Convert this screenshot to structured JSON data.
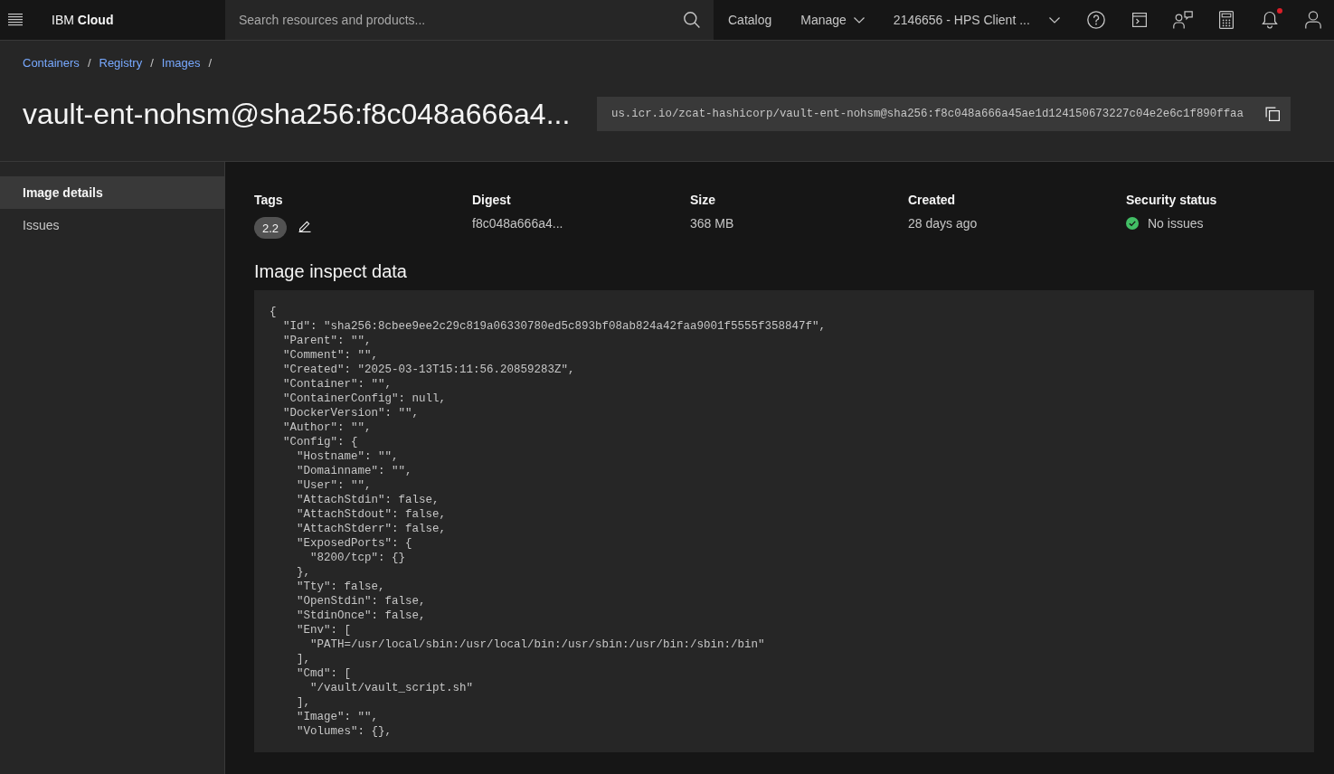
{
  "header": {
    "brand": "IBM **Cloud**",
    "search": {
      "placeholder": "Search resources and products..."
    },
    "nav": [
      {
        "label": "Catalog",
        "kind": "link"
      },
      {
        "label": "Manage",
        "kind": "menu"
      }
    ],
    "account": "2146656 - HPS Client ...",
    "notifications_unread": true
  },
  "breadcrumbs": {
    "items": [
      "Containers",
      "Registry",
      "Images"
    ],
    "separator": "/"
  },
  "title": "vault-ent-nohsm@sha256:f8c048a666a4...",
  "image_url": "us.icr.io/zcat-hashicorp/vault-ent-nohsm@sha256:f8c048a666a45ae1d124150673227c04e2e6c1f890ffaa",
  "sidebar": {
    "items": [
      {
        "label": "Image details",
        "selected": true
      },
      {
        "label": "Issues",
        "selected": false
      }
    ]
  },
  "details": [
    {
      "kind": "tags",
      "label": "Tags",
      "tags": [
        "2.2"
      ]
    },
    {
      "kind": "text",
      "label": "Digest",
      "value": "f8c048a666a4..."
    },
    {
      "kind": "text",
      "label": "Size",
      "value": "368 MB"
    },
    {
      "kind": "text",
      "label": "Created",
      "value": "28 days ago"
    },
    {
      "kind": "status",
      "label": "Security status",
      "value": "No issues"
    }
  ],
  "inspect": {
    "title": "Image inspect data",
    "code_lines": [
      "{",
      "  \"Id\": \"sha256:8cbee9ee2c29c819a06330780ed5c893bf08ab824a42faa9001f5555f358847f\",",
      "  \"Parent\": \"\",",
      "  \"Comment\": \"\",",
      "  \"Created\": \"2025-03-13T15:11:56.20859283Z\",",
      "  \"Container\": \"\",",
      "  \"ContainerConfig\": null,",
      "  \"DockerVersion\": \"\",",
      "  \"Author\": \"\",",
      "  \"Config\": {",
      "    \"Hostname\": \"\",",
      "    \"Domainname\": \"\",",
      "    \"User\": \"\",",
      "    \"AttachStdin\": false,",
      "    \"AttachStdout\": false,",
      "    \"AttachStderr\": false,",
      "    \"ExposedPorts\": {",
      "      \"8200/tcp\": {}",
      "    },",
      "    \"Tty\": false,",
      "    \"OpenStdin\": false,",
      "    \"StdinOnce\": false,",
      "    \"Env\": [",
      "      \"PATH=/usr/local/sbin:/usr/local/bin:/usr/sbin:/usr/bin:/sbin:/bin\"",
      "    ],",
      "    \"Cmd\": [",
      "      \"/vault/vault_script.sh\"",
      "    ],",
      "    \"Image\": \"\",",
      "    \"Volumes\": {},"
    ]
  }
}
